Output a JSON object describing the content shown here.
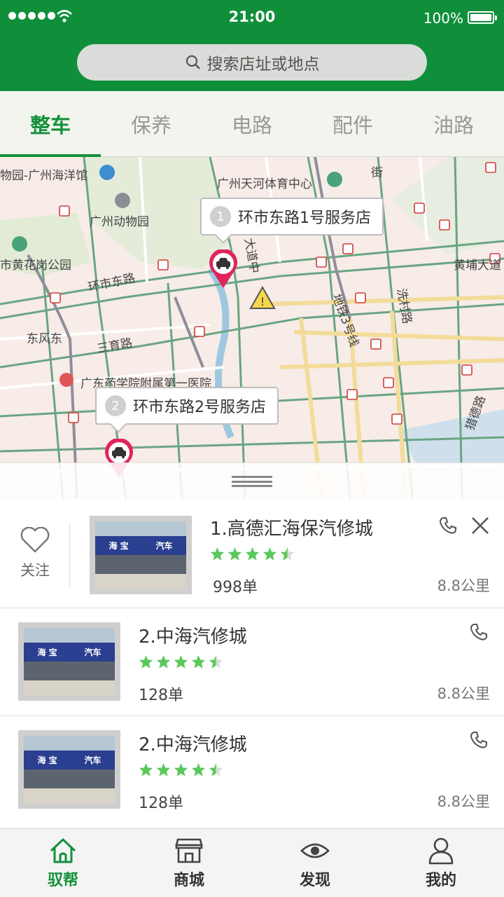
{
  "status_bar": {
    "time": "21:00",
    "battery": "100%",
    "battery_level": 1.0
  },
  "search": {
    "placeholder": "搜索店址或地点"
  },
  "tabs": [
    {
      "label": "整车",
      "active": true
    },
    {
      "label": "保养",
      "active": false
    },
    {
      "label": "电路",
      "active": false
    },
    {
      "label": "配件",
      "active": false
    },
    {
      "label": "油路",
      "active": false
    }
  ],
  "map": {
    "labels": {
      "zoo_ocean": "物园-广州海洋馆",
      "tianhe": "广州天河体育中心",
      "zoo": "广州动物园",
      "huanghuagang": "市黄花岗公园",
      "huanshi_road": "环市东路",
      "dafeng": "东风东",
      "sanyu": "三育路",
      "hospital": "广东药学院附属第一医院",
      "huangpu": "黄埔大道",
      "metro3": "地铁3号线",
      "xiancun": "洗村路",
      "liede": "猎德路",
      "dadao": "大道中",
      "jie": "街"
    },
    "callouts": [
      {
        "number": "1",
        "label": "环市东路1号服务店"
      },
      {
        "number": "2",
        "label": "环市东路2号服务店"
      }
    ]
  },
  "list": [
    {
      "name": "1.高德汇海保汽修城",
      "rating": 4.5,
      "orders": "998单",
      "distance": "8.8公里",
      "follow_label": "关注",
      "photo_sign": "海 宝",
      "photo_sign2": "汽车"
    },
    {
      "name": "2.中海汽修城",
      "rating": 4.5,
      "orders": "128单",
      "distance": "8.8公里",
      "photo_sign": "海 宝",
      "photo_sign2": "汽车"
    },
    {
      "name": "2.中海汽修城",
      "rating": 4.5,
      "orders": "128单",
      "distance": "8.8公里",
      "photo_sign": "海 宝",
      "photo_sign2": "汽车"
    }
  ],
  "bottom_nav": [
    {
      "label": "驭帮",
      "icon": "home-icon",
      "active": true
    },
    {
      "label": "商城",
      "icon": "store-icon",
      "active": false
    },
    {
      "label": "发现",
      "icon": "eye-icon",
      "active": false
    },
    {
      "label": "我的",
      "icon": "user-icon",
      "active": false
    }
  ],
  "colors": {
    "brand_green": "#0f8f3a",
    "star_green": "#5cc85c",
    "pin_red": "#e0245e"
  }
}
